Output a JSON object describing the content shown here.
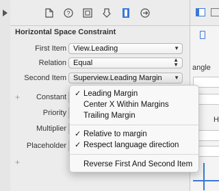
{
  "inspector": {
    "section_title": "Horizontal Space Constraint",
    "tabs": [
      "file-icon",
      "quick-help-icon",
      "identity-icon",
      "attributes-icon",
      "size-icon",
      "connections-icon"
    ],
    "first_item": {
      "label": "First Item",
      "value": "View.Leading"
    },
    "relation": {
      "label": "Relation",
      "value": "Equal"
    },
    "second_item": {
      "label": "Second Item",
      "value": "Superview.Leading Margin"
    },
    "constant": {
      "label": "Constant"
    },
    "priority": {
      "label": "Priority"
    },
    "multiplier": {
      "label": "Multiplier"
    },
    "placeholder": {
      "label": "Placeholder"
    },
    "plus_symbol": "+"
  },
  "menu": {
    "items": [
      {
        "label": "Leading Margin",
        "checked": true
      },
      {
        "label": "Center X Within Margins",
        "checked": false
      },
      {
        "label": "Trailing Margin",
        "checked": false
      },
      {
        "label": "Relative to margin",
        "checked": true
      },
      {
        "label": "Respect language direction",
        "checked": true
      },
      {
        "label": "Reverse First And Second Item",
        "checked": false
      }
    ],
    "check_glyph": "✓"
  },
  "right_panel": {
    "partial_text_1": "angle",
    "partial_text_2": "He"
  },
  "colors": {
    "accent": "#3a78d8",
    "menu_bg": "#f8f8f8",
    "panel_bg": "#ececec"
  }
}
